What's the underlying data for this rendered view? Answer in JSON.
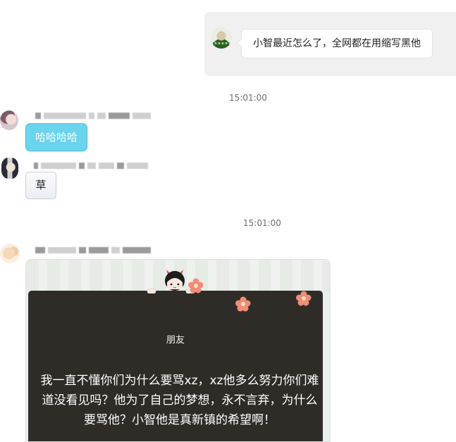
{
  "top_message": {
    "text": "小智最近怎么了，全网都在用缩写黑他"
  },
  "timestamps": [
    "15:01:00",
    "15:01:00"
  ],
  "messages": [
    {
      "text": "哈哈哈哈",
      "bubble_color": "#6ad3ee"
    },
    {
      "text": "草"
    }
  ],
  "image_card": {
    "label": "朋友",
    "text": "我一直不懂你们为什么要骂xz，xz他多么努力你们难道没看见吗？他为了自己的梦想，永不言弃，为什么要骂他？小智他是真新镇的希望啊！",
    "panel_color": "#2f2c28"
  }
}
